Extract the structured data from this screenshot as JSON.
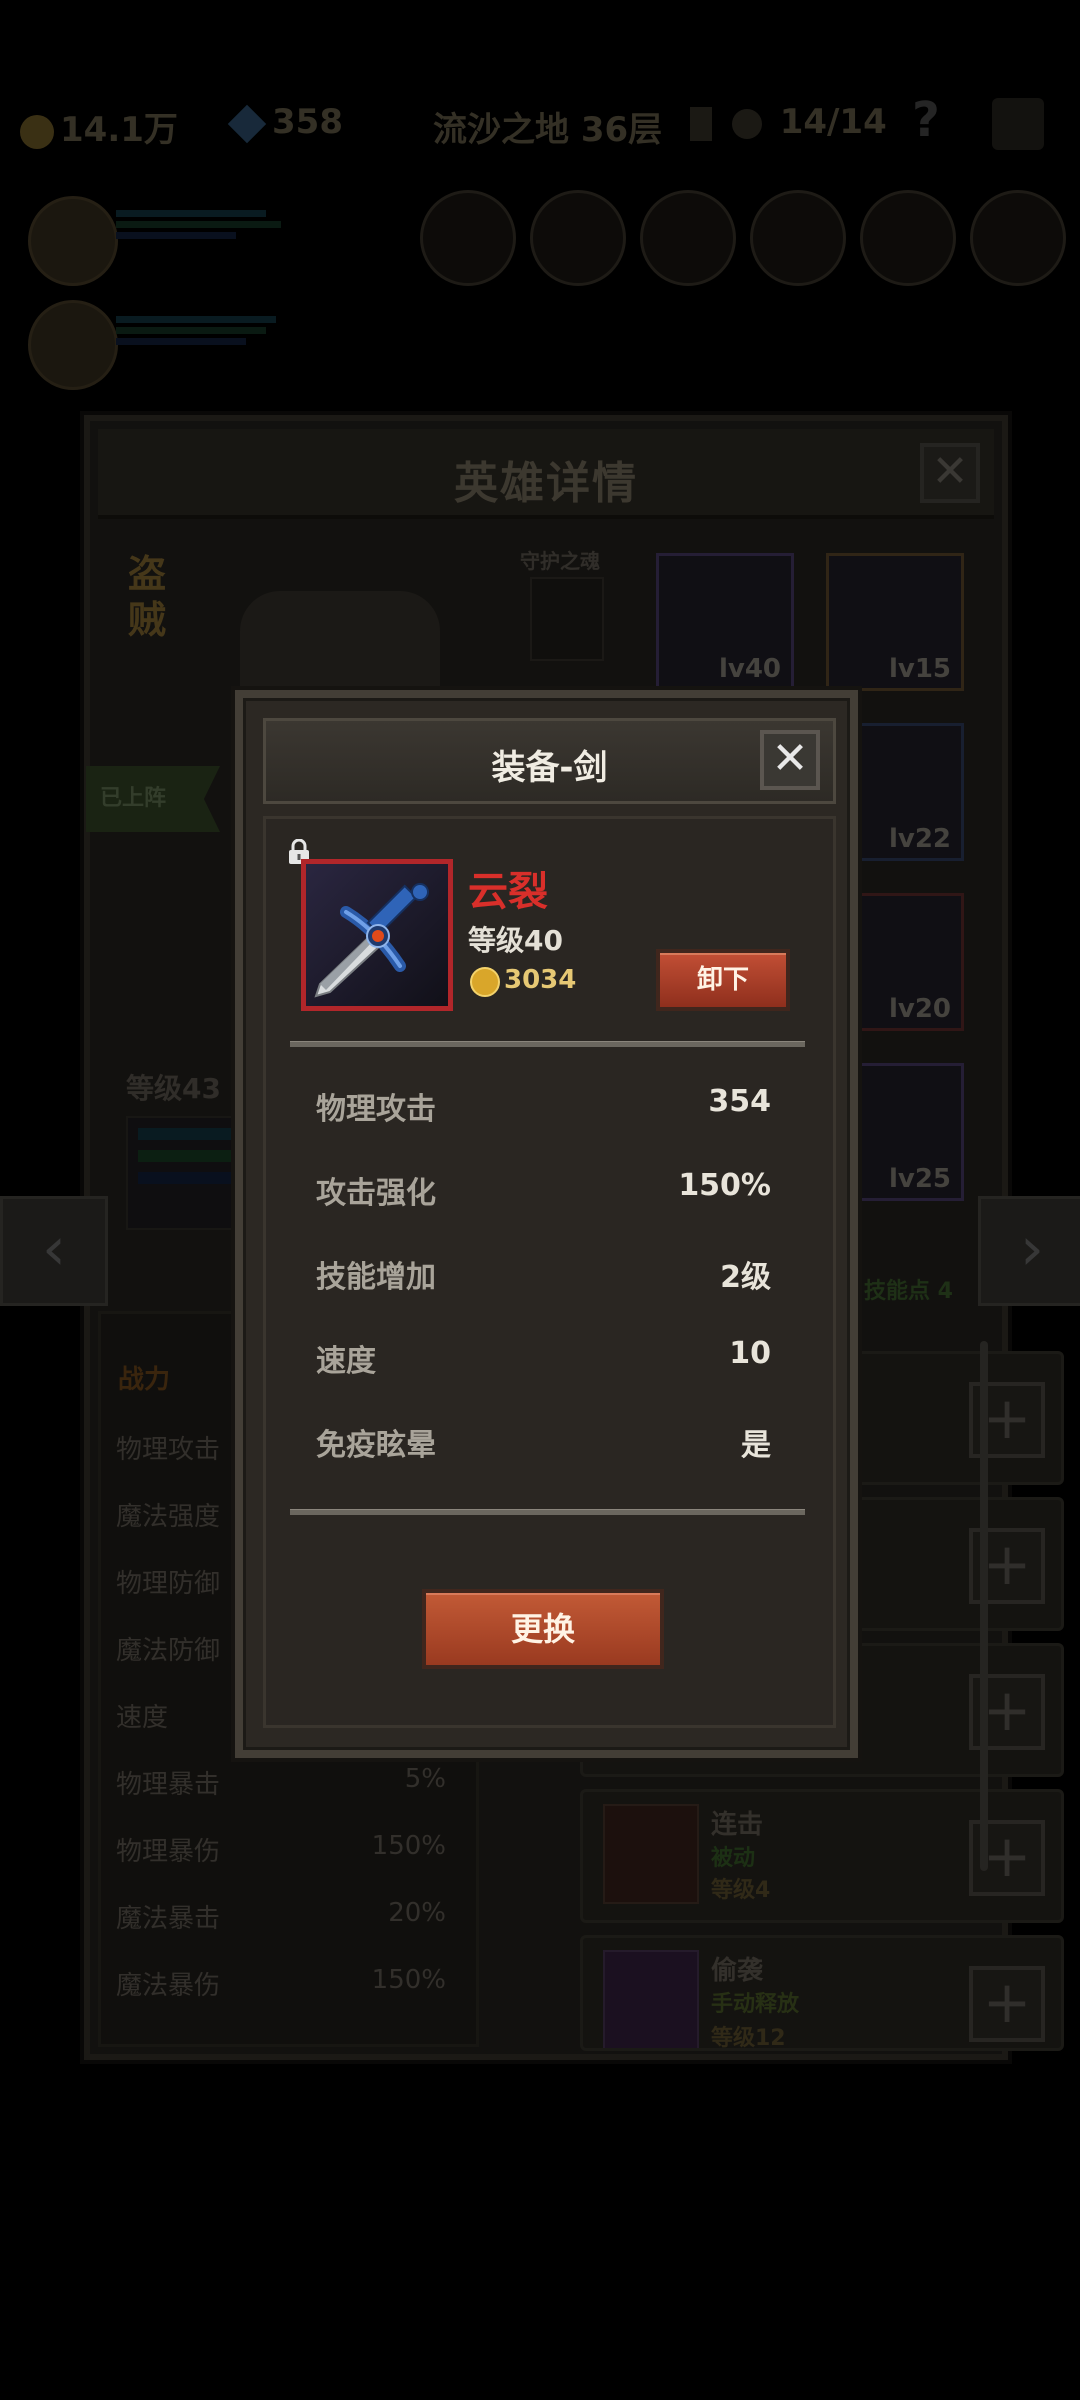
{
  "top_bar": {
    "gold": "14.1万",
    "gems": "358",
    "location": "流沙之地 36层",
    "keys": "14/14",
    "help": "?"
  },
  "hero_panel": {
    "title": "英雄详情",
    "close": "✕",
    "hero_class": "盗贼",
    "guardian_label": "守护之魂",
    "deployed_tag": "已上阵",
    "hero_level": "等级43",
    "skill_points": "技能点 4",
    "stats_header": "战力",
    "stats": [
      {
        "name": "物理攻击",
        "value": ""
      },
      {
        "name": "魔法强度",
        "value": ""
      },
      {
        "name": "物理防御",
        "value": ""
      },
      {
        "name": "魔法防御",
        "value": ""
      },
      {
        "name": "速度",
        "value": ""
      },
      {
        "name": "物理暴击",
        "value": "5%"
      },
      {
        "name": "物理暴伤",
        "value": "150%"
      },
      {
        "name": "魔法暴击",
        "value": "20%"
      },
      {
        "name": "魔法暴伤",
        "value": "150%"
      }
    ],
    "equipment": [
      {
        "level": "lv40"
      },
      {
        "level": "lv15"
      },
      {
        "level": "lv22"
      },
      {
        "level": "lv20"
      },
      {
        "level": "lv25"
      }
    ],
    "skills": [
      {
        "name": "连击",
        "type": "被动",
        "level": "等级4"
      },
      {
        "name": "偷袭",
        "type": "手动释放",
        "level": "等级12"
      }
    ],
    "nav_prev": "‹",
    "nav_next": "›",
    "plus": "+"
  },
  "popup": {
    "title": "装备-剑",
    "close": "✕",
    "item_name": "云裂",
    "item_level": "等级40",
    "gold_value": "3034",
    "unequip_button": "卸下",
    "replace_button": "更换",
    "attributes": [
      {
        "name": "物理攻击",
        "value": "354"
      },
      {
        "name": "攻击强化",
        "value": "150%"
      },
      {
        "name": "技能增加",
        "value": "2级"
      },
      {
        "name": "速度",
        "value": "10"
      },
      {
        "name": "免疫眩晕",
        "value": "是"
      }
    ],
    "colors": {
      "item_name": "#d92f2a",
      "gold": "#e6c874",
      "button": "#b3452d"
    }
  }
}
